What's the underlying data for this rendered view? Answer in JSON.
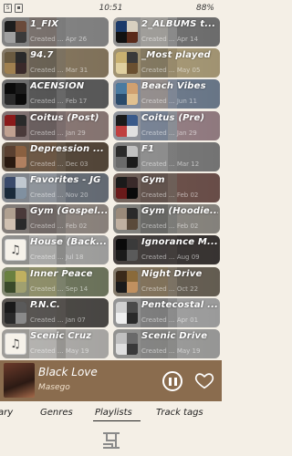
{
  "status": {
    "time": "10:51",
    "battery": "88%",
    "icons": [
      "S",
      "img"
    ]
  },
  "playlists": [
    {
      "title": "1_FIX",
      "subtitle": "Created ... Apr 26",
      "color": "#8a8a8a",
      "thumb": [
        "#1d1d1d",
        "#6a4a3a",
        "#a0a0a0",
        "#3a3a3a"
      ]
    },
    {
      "title": "2_ALBUMS t...",
      "subtitle": "Created ... Apr 14",
      "color": "#9a9a9a",
      "thumb": [
        "#1b3a6a",
        "#d8d0c0",
        "#111111",
        "#5a2a1a"
      ]
    },
    {
      "title": "94.7",
      "subtitle": "Created ... Mar 31",
      "color": "#8b7f6c",
      "thumb": [
        "#6a5a40",
        "#2a2a2a",
        "#a08050",
        "#3a2a2a"
      ]
    },
    {
      "title": "_Most played",
      "subtitle": "Created ... May 05",
      "color": "#a99a78",
      "thumb": [
        "#c8b070",
        "#3a3a3a",
        "#e0d0a0",
        "#6a5030"
      ]
    },
    {
      "title": "ACENSION",
      "subtitle": "Created ... Feb 17",
      "color": "#747474",
      "thumb": [
        "#0a0a0a",
        "#1a1a1a",
        "#2a2a2a",
        "#0a0a0a"
      ]
    },
    {
      "title": "Beach Vibes",
      "subtitle": "Created ... Jun 11",
      "color": "#8d96a6",
      "thumb": [
        "#4a7aa0",
        "#d0a070",
        "#2a4a6a",
        "#e0c090"
      ]
    },
    {
      "title": "Coitus (Post)",
      "subtitle": "Created ... Jan 29",
      "color": "#8a7a7a",
      "thumb": [
        "#8a1a1a",
        "#2a2a2a",
        "#c0a090",
        "#4a3a3a"
      ]
    },
    {
      "title": "Coitus (Pre)",
      "subtitle": "Created ... Jan 29",
      "color": "#9a9ea6",
      "thumb": [
        "#1a1a1a",
        "#3a5a8a",
        "#c04040",
        "#e0e0e0"
      ]
    },
    {
      "title": "Depression ...",
      "subtitle": "Created ... Dec 03",
      "color": "#6c5e4e",
      "thumb": [
        "#5a4030",
        "#8a6040",
        "#2a1a10",
        "#b08060"
      ]
    },
    {
      "title": "F1",
      "subtitle": "Created ... Mar 12",
      "color": "#8a8a8a",
      "thumb": [
        "#2a2a2a",
        "#c0c0c0",
        "#6a6a6a",
        "#1a1a1a"
      ]
    },
    {
      "title": "Favorites - JG",
      "subtitle": "Created ... Nov 20",
      "color": "#8a8f96",
      "thumb": [
        "#3a4a6a",
        "#c0c8d0",
        "#1a2a3a",
        "#8090a0"
      ]
    },
    {
      "title": "Gym",
      "subtitle": "Created ... Feb 02",
      "color": "#7a6a62",
      "thumb": [
        "#1a1a1a",
        "#3a2a2a",
        "#6a1a1a",
        "#0a0a0a"
      ]
    },
    {
      "title": "Gym (Gospel...",
      "subtitle": "Created ... Feb 02",
      "color": "#8a8480",
      "thumb": [
        "#b0a090",
        "#4a3a3a",
        "#d0c0b0",
        "#2a2a2a"
      ]
    },
    {
      "title": "Gym (Hoodie...",
      "subtitle": "Created ... Feb 02",
      "color": "#8a8a86",
      "thumb": [
        "#9a8a7a",
        "#2a2a2a",
        "#c0b0a0",
        "#5a4a3a"
      ]
    },
    {
      "title": "House (Back...",
      "subtitle": "Created ... Jul 18",
      "color": "#9a9a98",
      "thumb": null
    },
    {
      "title": "Ignorance M...",
      "subtitle": "Created ... Aug 09",
      "color": "#4a4442",
      "thumb": [
        "#0a0a0a",
        "#3a3a3a",
        "#1a1a1a",
        "#5a5a5a"
      ]
    },
    {
      "title": "Inner Peace",
      "subtitle": "Created ... Sep 14",
      "color": "#8a9078",
      "thumb": [
        "#6a8040",
        "#c0b060",
        "#3a4a2a",
        "#a0a070"
      ]
    },
    {
      "title": "Night Drive",
      "subtitle": "Created ... Oct 22",
      "color": "#8a8070",
      "thumb": [
        "#3a2a1a",
        "#8a6a3a",
        "#1a1a1a",
        "#c09060"
      ]
    },
    {
      "title": "P.N.C.",
      "subtitle": "Created ... Jan 07",
      "color": "#5e5a56",
      "thumb": [
        "#1a1a1a",
        "#5a5a5a",
        "#2a2a2a",
        "#8a8a8a"
      ]
    },
    {
      "title": "Pentecostal ...",
      "subtitle": "Created ... Apr 01",
      "color": "#9c9c9c",
      "thumb": [
        "#d0d0d0",
        "#4a4a4a",
        "#f0f0f0",
        "#2a2a2a"
      ]
    },
    {
      "title": "Scenic Cruz",
      "subtitle": "Created ... May 19",
      "color": "#a8a6a2",
      "thumb": null
    },
    {
      "title": "Scenic Drive",
      "subtitle": "Created ... May 19",
      "color": "#9a9a98",
      "thumb": [
        "#c0c0c0",
        "#6a6a6a",
        "#e0e0e0",
        "#3a3a3a"
      ]
    }
  ],
  "player": {
    "title": "Black Love",
    "artist": "Masego"
  },
  "tabs": [
    {
      "label": "ary",
      "active": false
    },
    {
      "label": "Genres",
      "active": false
    },
    {
      "label": "Playlists",
      "active": true
    },
    {
      "label": "Track tags",
      "active": false
    }
  ],
  "colors": {
    "background": "#f4efe6",
    "player_bg": "#8a6c4e",
    "text_dark": "#222222"
  }
}
